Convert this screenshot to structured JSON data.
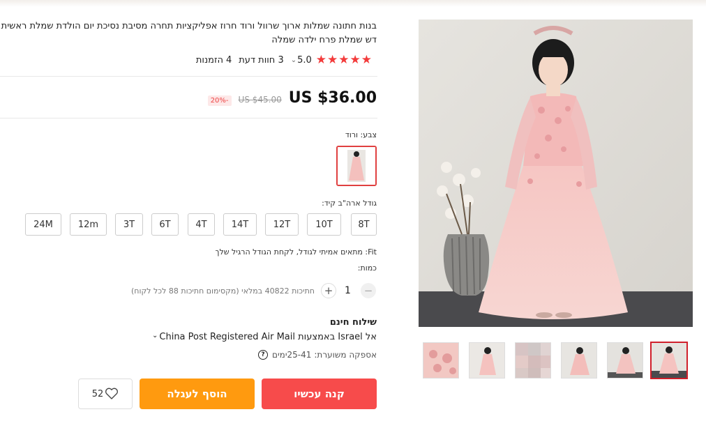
{
  "product": {
    "title_line1": "בנות חתונה שמלות ארוך שרוול ורוד חרוז אפליקציות תחרה מסיבת נסיכת יום הולדת שמלת ראשית הקו",
    "title_line2": "דש שמלת פרח ילדה שמלה",
    "rating": "5.0",
    "rating_caret": "⌄",
    "reviews": "3 חוות דעת",
    "orders_count": "4",
    "orders_label": "הזמנות",
    "stars": "★★★★★"
  },
  "price": {
    "current": "US $36.00",
    "original": "US $45.00",
    "discount": "-20%"
  },
  "color": {
    "label": "צבע: ורוד"
  },
  "size": {
    "label": "גודל ארה\"ב קיד:",
    "options": [
      "8T",
      "10T",
      "12T",
      "14T",
      "4T",
      "6T",
      "3T",
      "12m",
      "24M"
    ],
    "fit_note": "Fit: מתאים אמיתי לגודל, לקחת הגודל הרגיל שלך"
  },
  "quantity": {
    "label": "כמות:",
    "value": "1",
    "minus": "−",
    "plus": "+",
    "available": "חתיכות 40822 במלאי (מקסימום חתיכות 88 לכל לקוח)"
  },
  "shipping": {
    "title": "שילוח חינם",
    "route": "אל Israel באמצעות China Post Registered Air Mail",
    "caret": "⌄",
    "estimate_label": "אספקה משוערת:",
    "estimate_value": "25-41ימים"
  },
  "actions": {
    "buy_now": "קנה עכשיו",
    "add_to_cart": "הוסף לעגלה",
    "wishlist_count": "52"
  },
  "colors": {
    "buy_now": "#f74b4b",
    "add_to_cart": "#ff9a0f",
    "star": "#f33b3b",
    "selected_border": "#d0202b"
  }
}
